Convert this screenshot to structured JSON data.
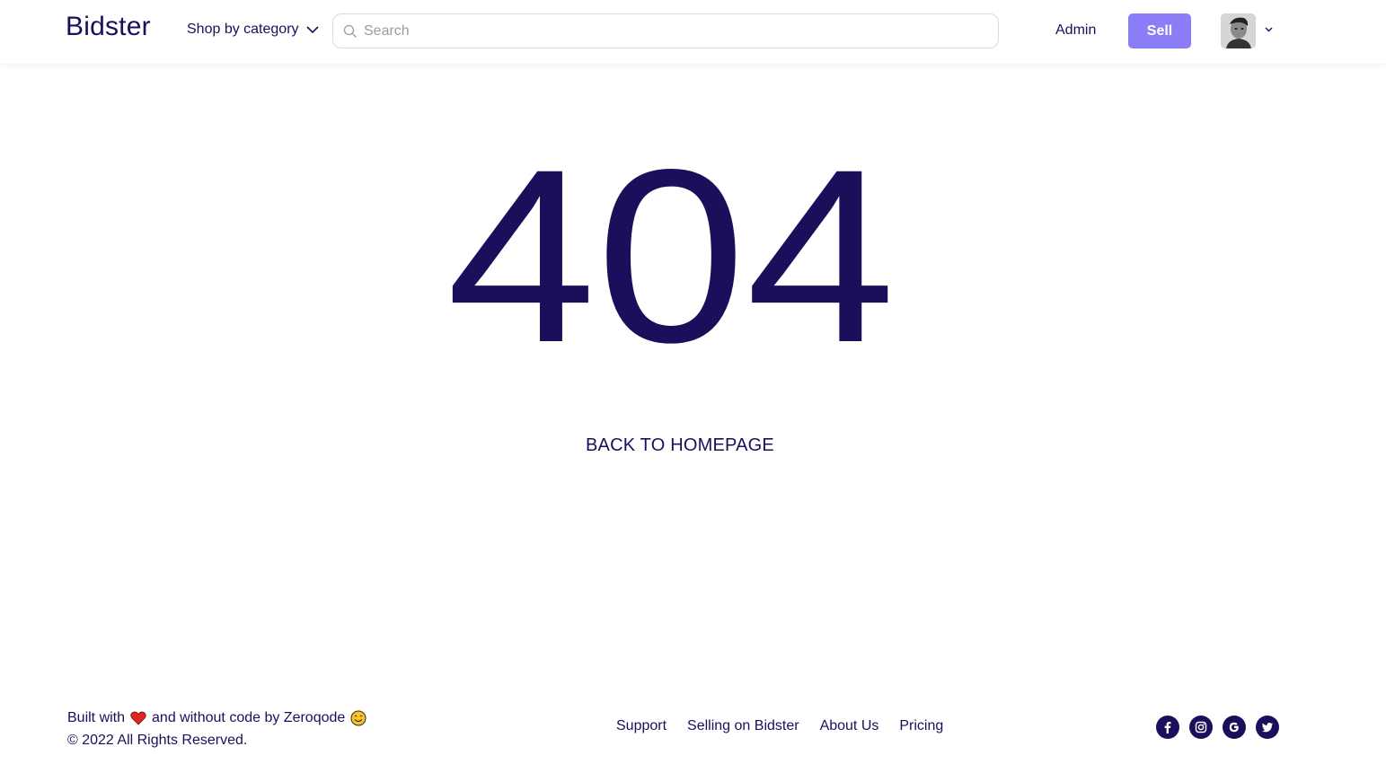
{
  "header": {
    "logo": "Bidster",
    "category_label": "Shop by category",
    "search_placeholder": "Search",
    "admin_label": "Admin",
    "sell_label": "Sell"
  },
  "error": {
    "code": "404",
    "back_label": "BACK TO HOMEPAGE"
  },
  "footer": {
    "built_prefix": "Built with",
    "built_suffix": "and without code by Zeroqode",
    "copyright": "© 2022 All Rights Reserved.",
    "links": [
      "Support",
      "Selling on Bidster",
      "About Us",
      "Pricing"
    ],
    "socials": [
      "facebook-icon",
      "instagram-icon",
      "google-icon",
      "twitter-icon"
    ]
  },
  "colors": {
    "primary": "#1b0f5c",
    "accent": "#8b7cf8",
    "heart": "#e02424",
    "background": "#ffffff"
  }
}
